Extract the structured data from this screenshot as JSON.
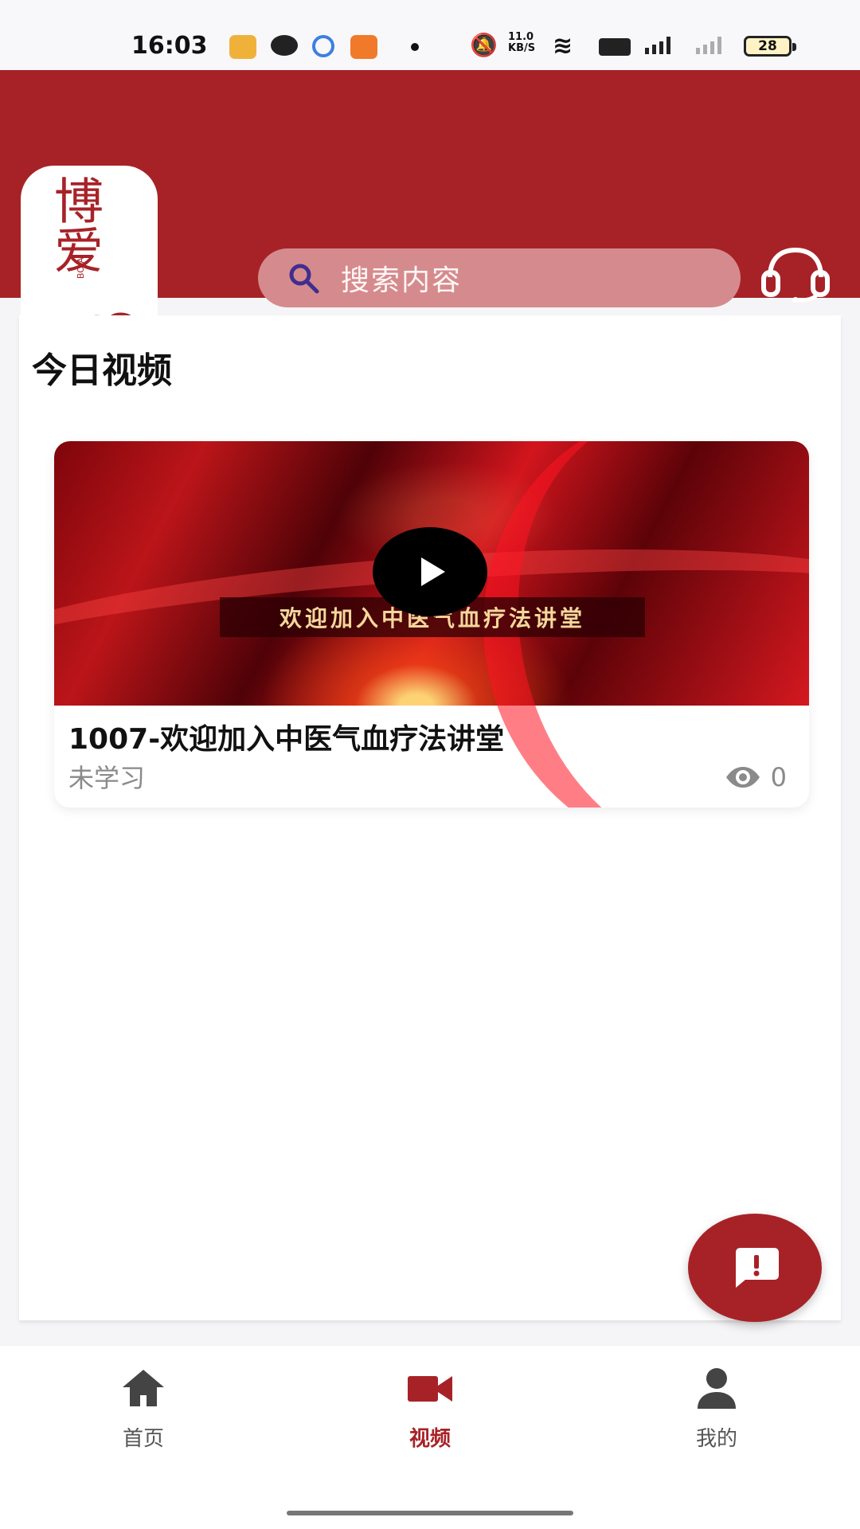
{
  "status_bar": {
    "time": "16:03",
    "network_speed": "11.0\nKB/S",
    "battery": "28"
  },
  "header": {
    "logo_text": "博爱",
    "logo_subtitle": "BO Ai",
    "search_placeholder": "搜索内容"
  },
  "main": {
    "section_title": "今日视频",
    "video": {
      "thumbnail_caption": "欢迎加入中医气血疗法讲堂",
      "title": "1007-欢迎加入中医气血疗法讲堂",
      "status": "未学习",
      "views": "0"
    }
  },
  "bottom_nav": [
    {
      "label": "首页",
      "icon": "home-icon"
    },
    {
      "label": "视频",
      "icon": "video-camera-icon",
      "selected": true
    },
    {
      "label": "我的",
      "icon": "person-icon"
    }
  ],
  "colors": {
    "brand_red": "#a72227",
    "search_bg": "#d58b8d",
    "inactive_text": "#555555",
    "muted_text": "#8a8a8a"
  }
}
